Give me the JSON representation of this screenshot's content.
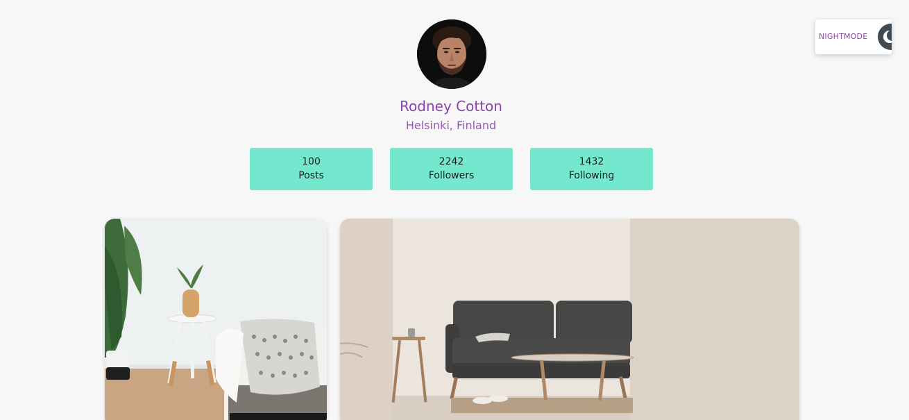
{
  "nightmode": {
    "label": "NIGHTMODE",
    "icon": "moon-icon"
  },
  "profile": {
    "name": "Rodney Cotton",
    "location": "Helsinki, Finland"
  },
  "stats": [
    {
      "value": "100",
      "label": "Posts"
    },
    {
      "value": "2242",
      "label": "Followers"
    },
    {
      "value": "1432",
      "label": "Following"
    }
  ],
  "colors": {
    "accent": "#8e44ad",
    "stat_bg": "#73e8cf",
    "background": "#f7f7f7"
  }
}
